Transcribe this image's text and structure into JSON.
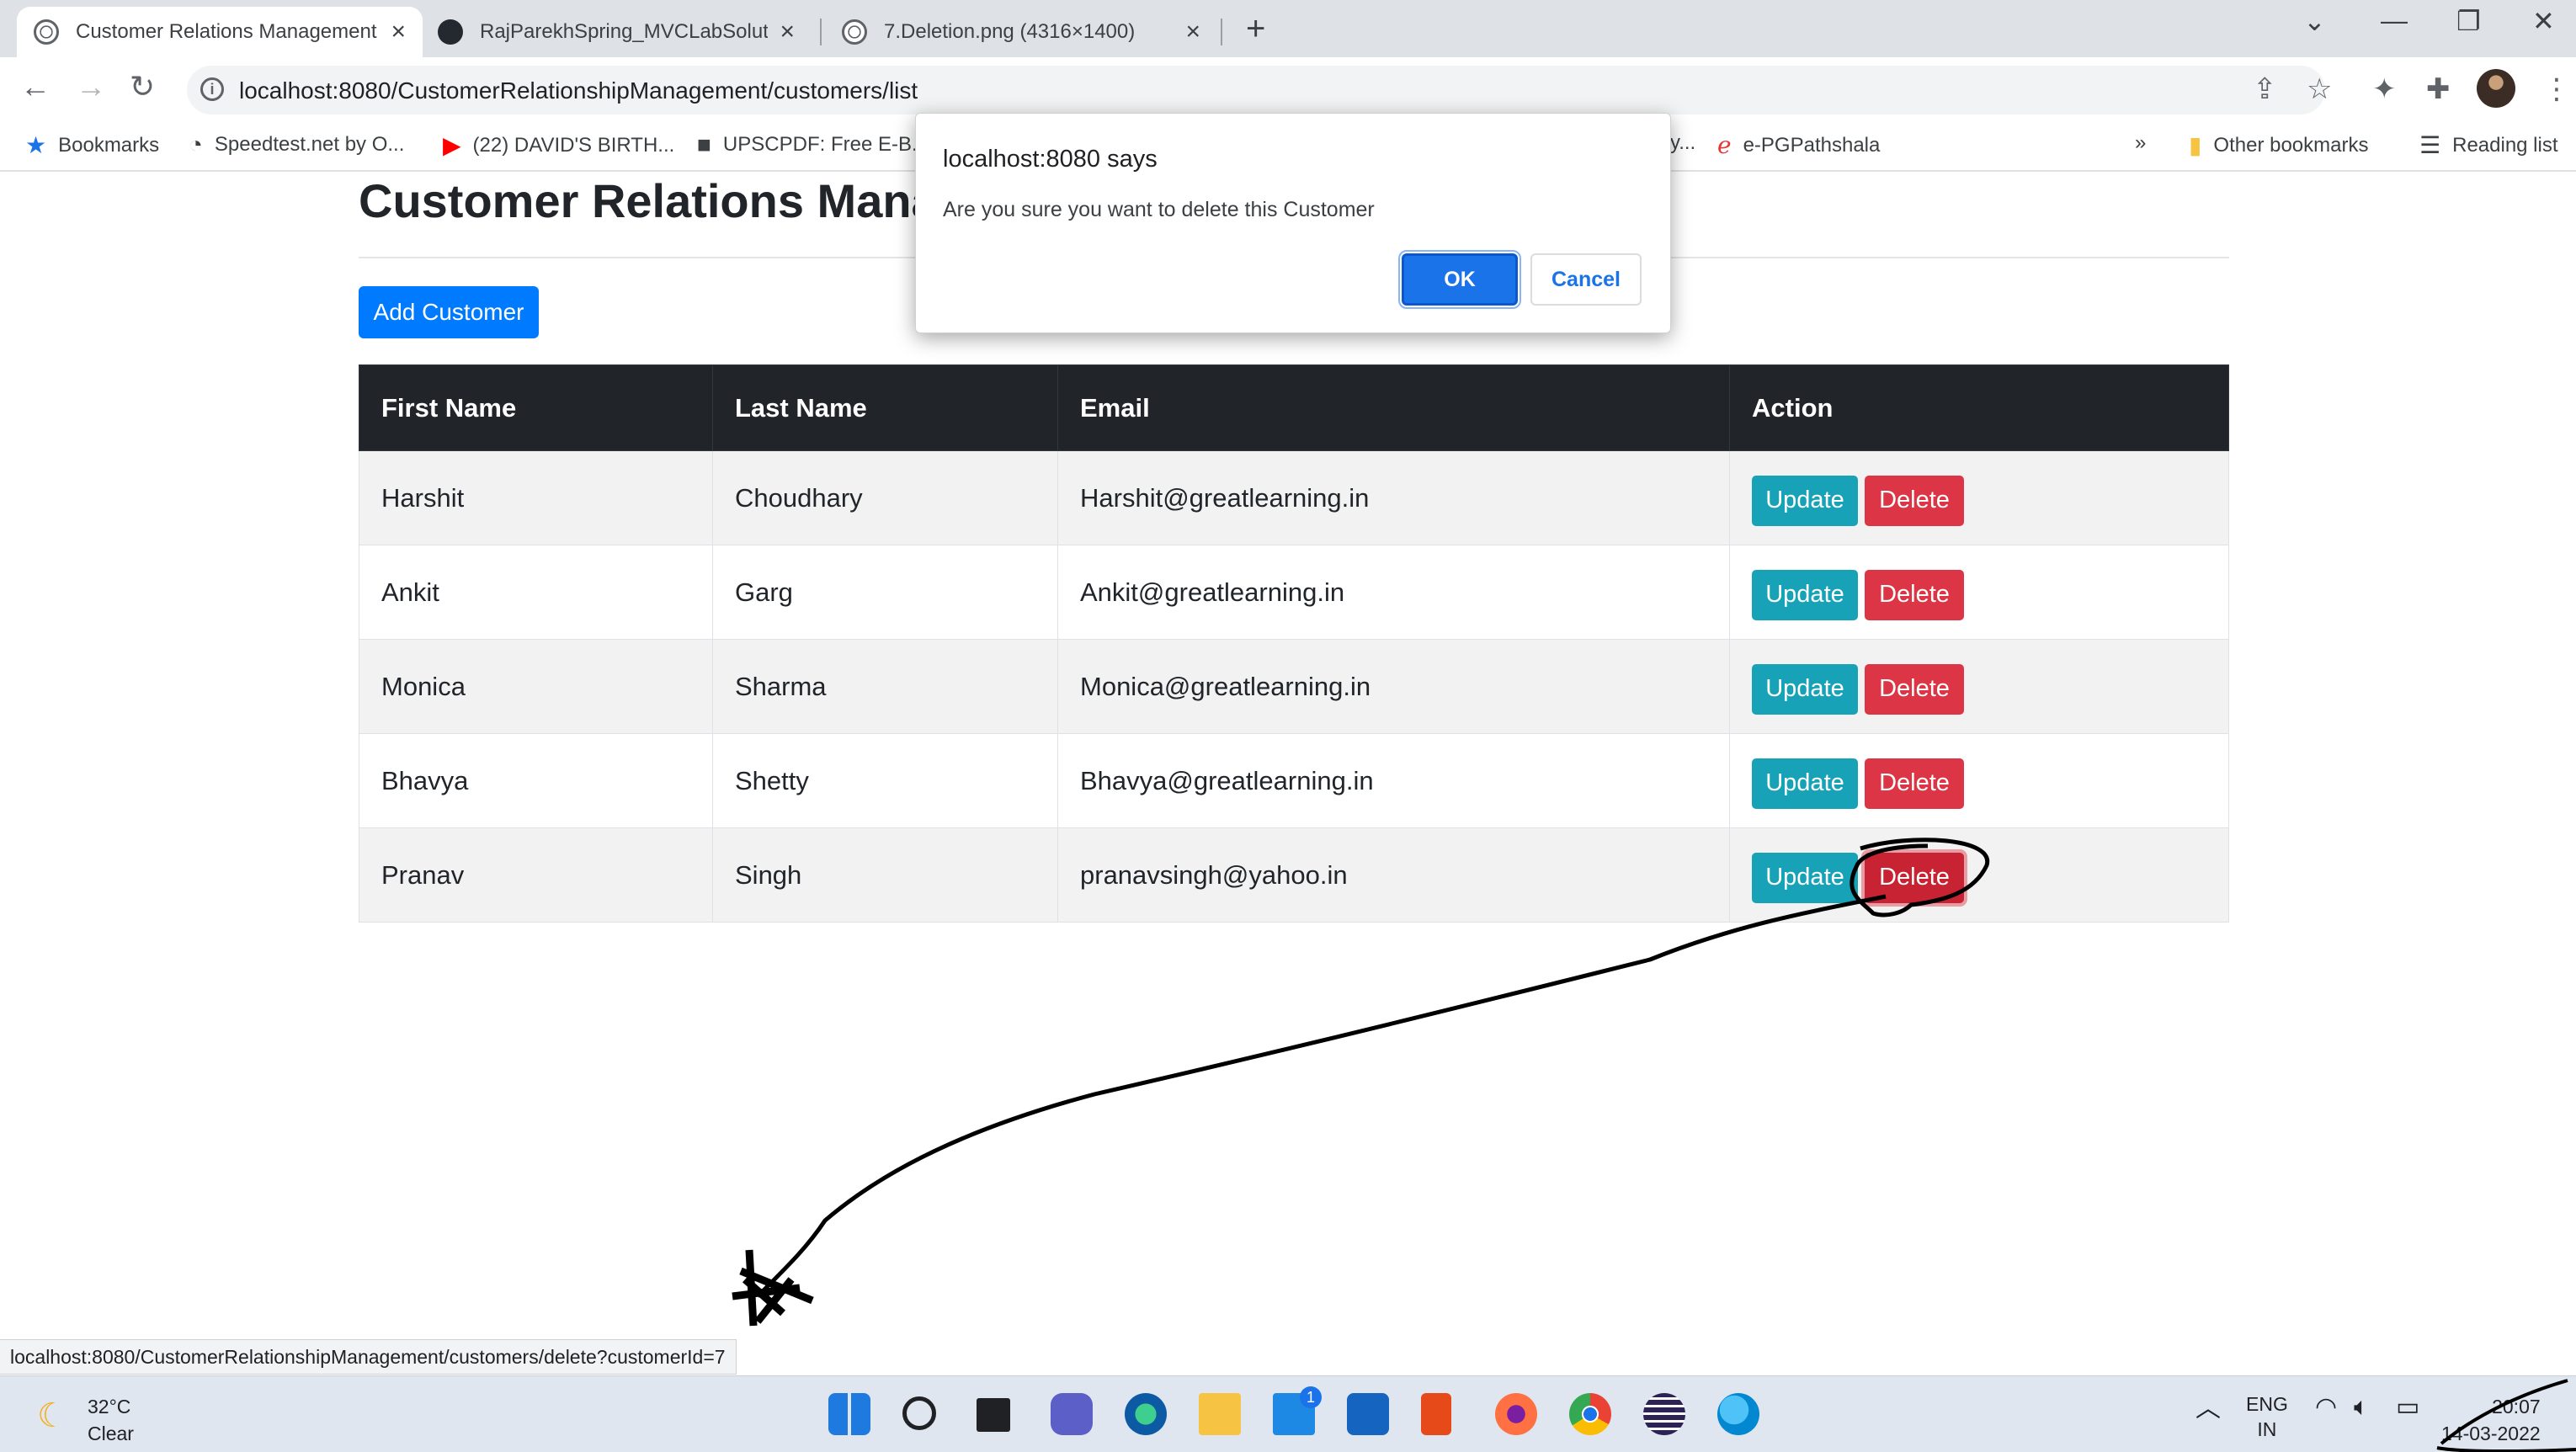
{
  "browser": {
    "tabs": [
      {
        "title": "Customer Relations Management",
        "active": true
      },
      {
        "title": "RajParekhSpring_MVCLabSolution",
        "active": false
      },
      {
        "title": "7.Deletion.png (4316×1400)",
        "active": false
      }
    ],
    "url": "localhost:8080/CustomerRelationshipManagement/customers/list",
    "bookmarks": [
      "Bookmarks",
      "Speedtest.net by O...",
      "(22) DAVID'S BIRTH...",
      "UPSCPDF: Free E-B...",
      "y...",
      "e-PGPathshala",
      "»",
      "Other bookmarks",
      "Reading list"
    ],
    "status_url": "localhost:8080/CustomerRelationshipManagement/customers/delete?customerId=7"
  },
  "page": {
    "title": "Customer Relations Manag",
    "add_button": "Add Customer",
    "table": {
      "headers": [
        "First Name",
        "Last Name",
        "Email",
        "Action"
      ],
      "rows": [
        {
          "first": "Harshit",
          "last": "Choudhary",
          "email": "Harshit@greatlearning.in"
        },
        {
          "first": "Ankit",
          "last": "Garg",
          "email": "Ankit@greatlearning.in"
        },
        {
          "first": "Monica",
          "last": "Sharma",
          "email": "Monica@greatlearning.in"
        },
        {
          "first": "Bhavya",
          "last": "Shetty",
          "email": "Bhavya@greatlearning.in"
        },
        {
          "first": "Pranav",
          "last": "Singh",
          "email": "pranavsingh@yahoo.in"
        }
      ],
      "update_label": "Update",
      "delete_label": "Delete"
    }
  },
  "dialog": {
    "title": "localhost:8080 says",
    "message": "Are you sure you want to delete this Customer",
    "ok_label": "OK",
    "cancel_label": "Cancel"
  },
  "taskbar": {
    "temperature": "32°C",
    "weather": "Clear",
    "lang_line1": "ENG",
    "lang_line2": "IN",
    "time": "20:07",
    "date": "14-03-2022",
    "mail_badge": "1"
  },
  "colors": {
    "primary": "#007bff",
    "info": "#17a2b8",
    "danger": "#dc3545",
    "table_header": "#212529",
    "dialog_ok": "#1a73e8"
  },
  "icons": [
    "back-icon",
    "forward-icon",
    "reload-icon",
    "info-icon",
    "share-icon",
    "star-icon",
    "extensions-icon",
    "menu-icon",
    "windows-start-icon",
    "search-icon"
  ]
}
